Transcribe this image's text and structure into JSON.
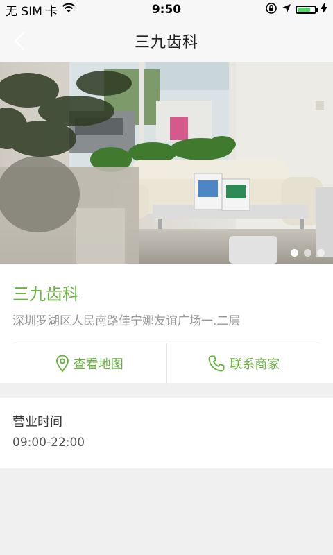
{
  "status_bar": {
    "carrier": "无 SIM 卡",
    "time": "9:50",
    "battery_level": 0.7
  },
  "header": {
    "title": "三九齿科"
  },
  "carousel": {
    "slide_count": 3,
    "active_index": 0
  },
  "shop": {
    "name": "三九齿科",
    "address": "深圳罗湖区人民南路佳宁娜友谊广场一.二层"
  },
  "actions": {
    "map_label": "查看地图",
    "contact_label": "联系商家"
  },
  "hours": {
    "label": "营业时间",
    "value": "09:00-22:00"
  },
  "colors": {
    "accent": "#6ab342",
    "background": "#f0f0f0",
    "battery": "#4cd964"
  },
  "icons": [
    "wifi-icon",
    "lock-rotation-icon",
    "location-arrow-icon",
    "charging-bolt-icon",
    "back-chevron-icon",
    "map-pin-icon",
    "phone-icon"
  ]
}
